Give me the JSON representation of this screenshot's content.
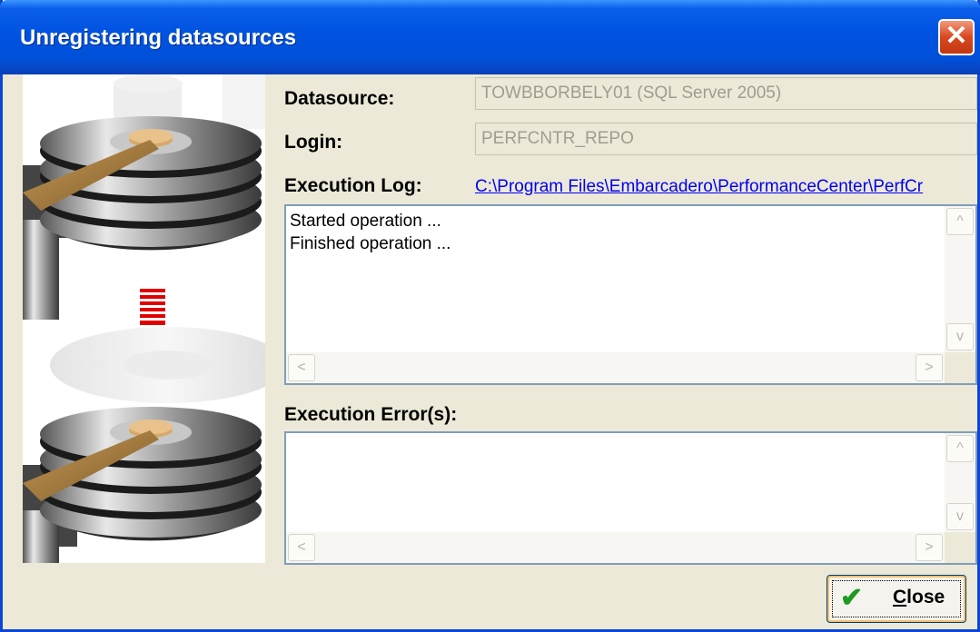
{
  "window": {
    "title": "Unregistering datasources",
    "close_glyph": "✕"
  },
  "form": {
    "datasource_label": "Datasource:",
    "datasource_value": "TOWBBORBELY01 (SQL Server 2005)",
    "login_label": "Login:",
    "login_value": "PERFCNTR_REPO",
    "log_label": "Execution Log:",
    "log_path": "C:\\Program Files\\Embarcadero\\PerformanceCenter\\PerfCr",
    "errors_label": "Execution Error(s):"
  },
  "log_lines": [
    "Started operation ...",
    "Finished operation ..."
  ],
  "errors_text": "",
  "buttons": {
    "close_label_first": "C",
    "close_label_rest": "lose"
  },
  "scroll_glyphs": {
    "up": "^",
    "down": "v",
    "left": "<",
    "right": ">"
  },
  "icons": [
    "close-icon",
    "checkmark-icon",
    "hard-disk-icon",
    "down-arrow-icon"
  ],
  "colors": {
    "title_bar": "#0053e1",
    "close_red": "#d9481f",
    "link_blue": "#0000ee",
    "arrow_red": "#e00000"
  }
}
